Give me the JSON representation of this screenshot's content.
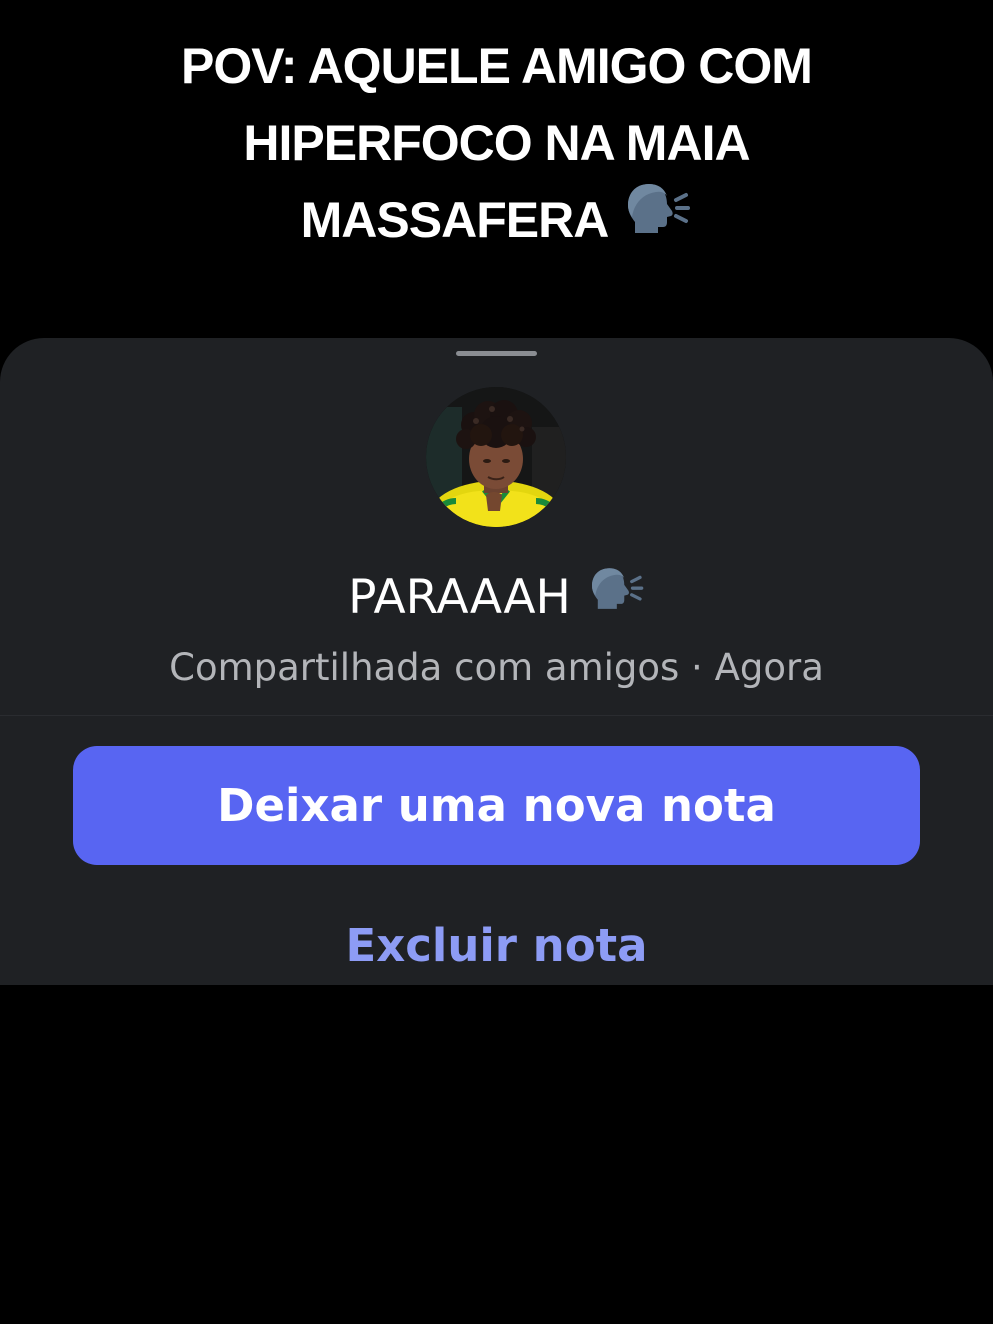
{
  "caption": {
    "line1": "POV: AQUELE AMIGO COM",
    "line2": "HIPERFOCO NA MAIA",
    "line3": "MASSAFERA",
    "emoji_icon": "speaking-head-icon"
  },
  "note": {
    "text": "PARAAAH",
    "emoji_icon": "speaking-head-icon",
    "meta": "Compartilhada com amigos · Agora"
  },
  "actions": {
    "primary_label": "Deixar uma nova nota",
    "secondary_label": "Excluir nota"
  },
  "colors": {
    "sheet_background": "#1f2124",
    "primary_button": "#5865f2",
    "secondary_link": "#8d9cf5",
    "meta_text": "#b3b5b9"
  }
}
